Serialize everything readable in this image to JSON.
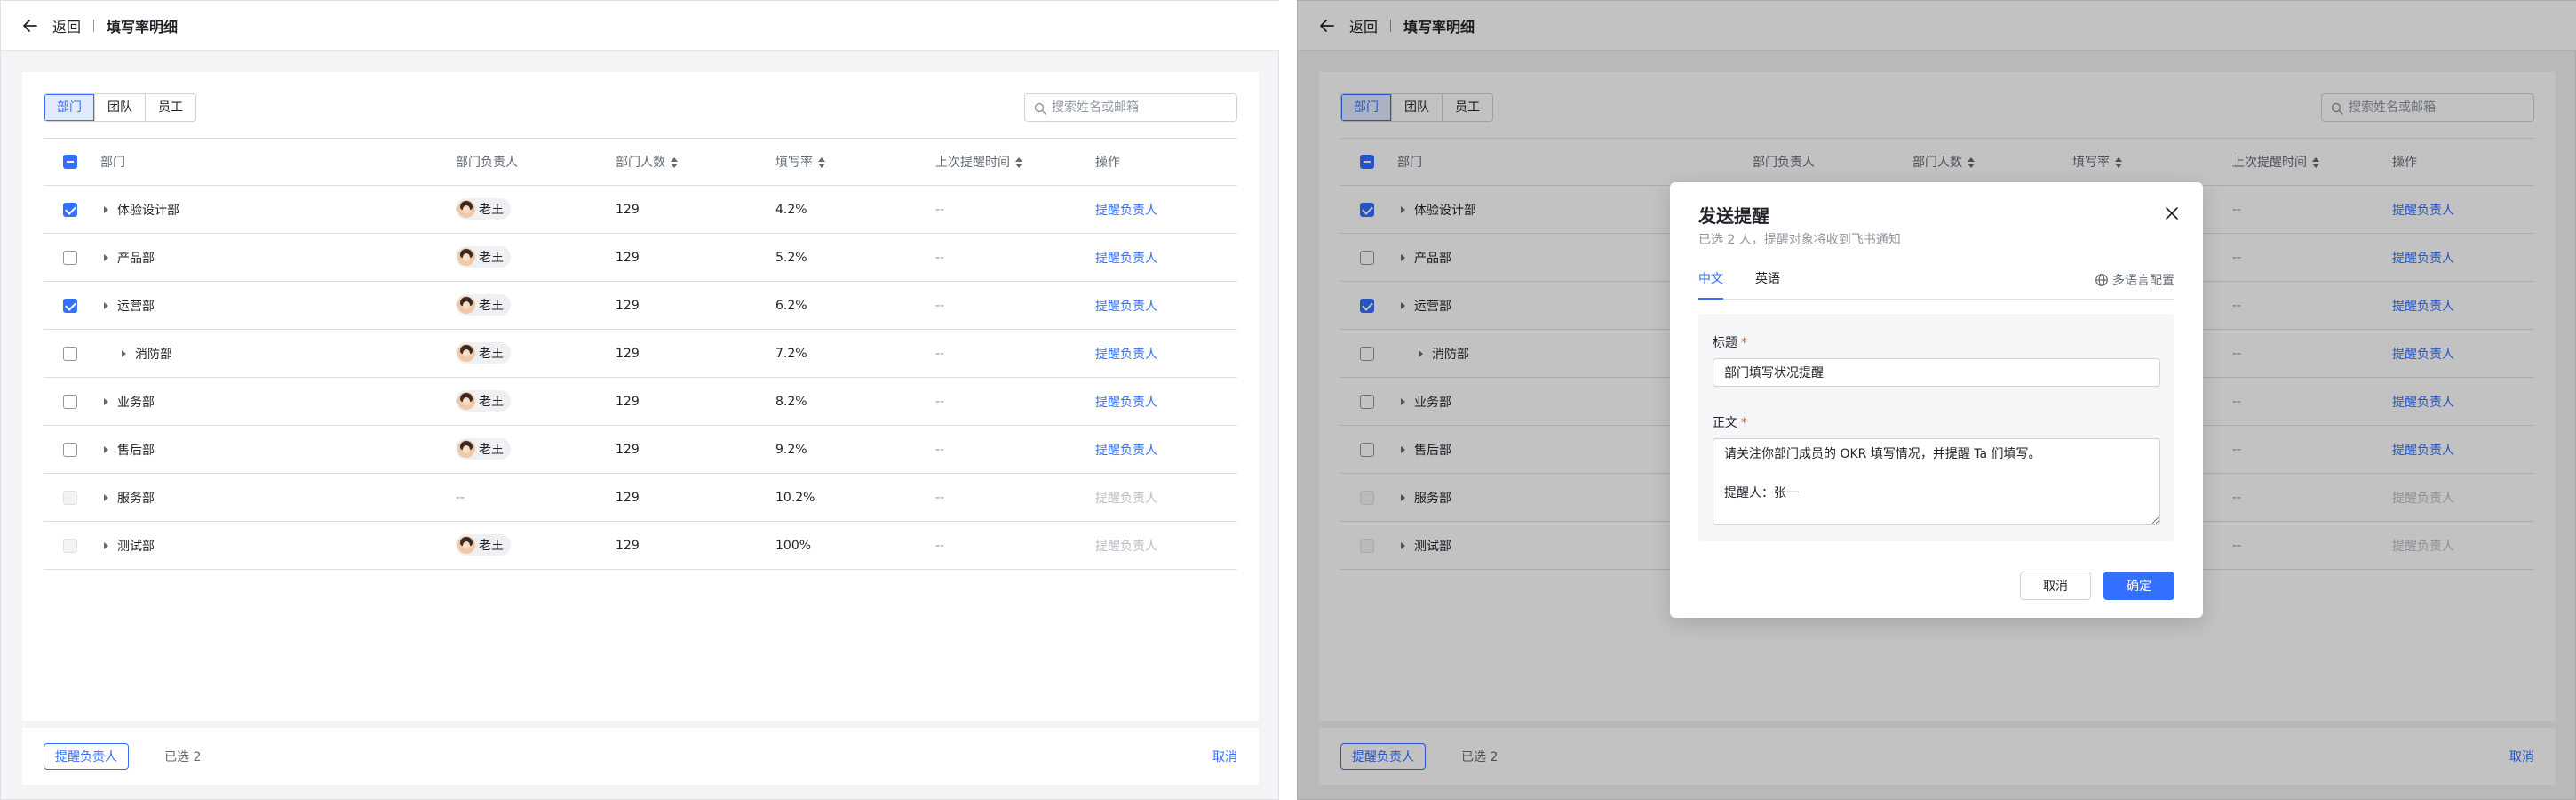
{
  "header": {
    "back_label": "返回",
    "page_title": "填写率明细"
  },
  "view_tabs": [
    {
      "label": "部门",
      "active": true
    },
    {
      "label": "团队",
      "active": false
    },
    {
      "label": "员工",
      "active": false
    }
  ],
  "search": {
    "placeholder": "搜索姓名或邮箱"
  },
  "table": {
    "columns": {
      "dept": "部门",
      "owner": "部门负责人",
      "count": "部门人数",
      "rate": "填写率",
      "last_remind": "上次提醒时间",
      "action": "操作"
    },
    "rows": [
      {
        "dept": "体验设计部",
        "owner": "老王",
        "count": "129",
        "rate": "4.2%",
        "last_remind": "--",
        "action": "提醒负责人",
        "checked": true,
        "disabled": false,
        "level": 0
      },
      {
        "dept": "产品部",
        "owner": "老王",
        "count": "129",
        "rate": "5.2%",
        "last_remind": "--",
        "action": "提醒负责人",
        "checked": false,
        "disabled": false,
        "level": 0
      },
      {
        "dept": "运营部",
        "owner": "老王",
        "count": "129",
        "rate": "6.2%",
        "last_remind": "--",
        "action": "提醒负责人",
        "checked": true,
        "disabled": false,
        "level": 0
      },
      {
        "dept": "消防部",
        "owner": "老王",
        "count": "129",
        "rate": "7.2%",
        "last_remind": "--",
        "action": "提醒负责人",
        "checked": false,
        "disabled": false,
        "level": 1
      },
      {
        "dept": "业务部",
        "owner": "老王",
        "count": "129",
        "rate": "8.2%",
        "last_remind": "--",
        "action": "提醒负责人",
        "checked": false,
        "disabled": false,
        "level": 0
      },
      {
        "dept": "售后部",
        "owner": "老王",
        "count": "129",
        "rate": "9.2%",
        "last_remind": "--",
        "action": "提醒负责人",
        "checked": false,
        "disabled": false,
        "level": 0
      },
      {
        "dept": "服务部",
        "owner": "--",
        "count": "129",
        "rate": "10.2%",
        "last_remind": "--",
        "action": "提醒负责人",
        "checked": false,
        "disabled": true,
        "level": 0
      },
      {
        "dept": "测试部",
        "owner": "老王",
        "count": "129",
        "rate": "100%",
        "last_remind": "--",
        "action": "提醒负责人",
        "checked": false,
        "disabled": true,
        "level": 0
      }
    ]
  },
  "footer": {
    "remind_button": "提醒负责人",
    "selected_count": "已选 2",
    "cancel": "取消"
  },
  "modal": {
    "title": "发送提醒",
    "subtitle": "已选 2 人，提醒对象将收到飞书通知",
    "tabs": [
      "中文",
      "英语"
    ],
    "lang_config": "多语言配置",
    "title_label": "标题",
    "required_mark": "*",
    "title_value": "部门填写状况提醒",
    "body_label": "正文",
    "body_value": "请关注你部门成员的 OKR 填写情况，并提醒 Ta 们填写。\n\n提醒人：张一",
    "cancel": "取消",
    "confirm": "确定"
  },
  "colors": {
    "accent": "#3370ff",
    "required": "#f54a45",
    "overlay": "rgba(0,0,0,0.24)"
  }
}
